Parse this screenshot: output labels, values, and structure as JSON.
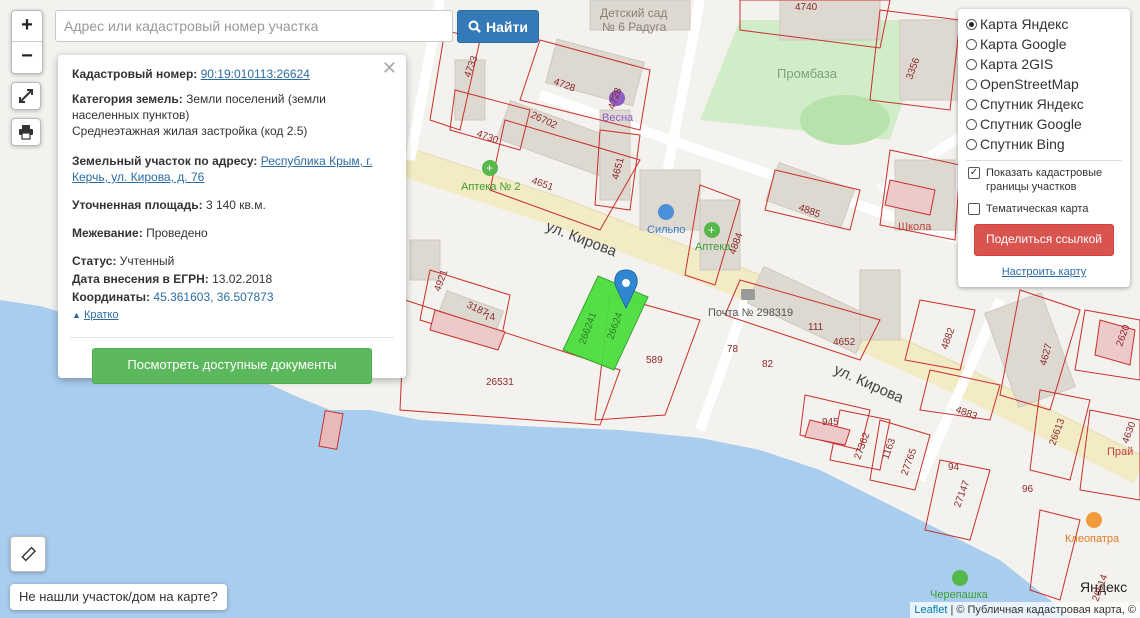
{
  "search": {
    "placeholder": "Адрес или кадастровый номер участка",
    "button_label": "Найти"
  },
  "zoom": {
    "in": "+",
    "out": "−"
  },
  "popup": {
    "cadastral_label": "Кадастровый номер:",
    "cadastral_value": "90:19:010113:26624",
    "category_label": "Категория земель:",
    "category_value": "Земли поселений (земли населенных пунктов)",
    "usage_value": "Среднеэтажная жилая застройка (код 2.5)",
    "address_label": "Земельный участок по адресу:",
    "address_value": "Республика Крым, г. Керчь, ул. Кирова, д. 76",
    "area_label": "Уточненная площадь:",
    "area_value": "3 140 кв.м.",
    "survey_label": "Межевание:",
    "survey_value": "Проведено",
    "status_label": "Статус:",
    "status_value": "Учтенный",
    "date_label": "Дата внесения в ЕГРН:",
    "date_value": "13.02.2018",
    "coords_label": "Координаты:",
    "coords_value": "45.361603, 36.507873",
    "brief_link": "Кратко",
    "docs_button": "Посмотреть доступные документы"
  },
  "layers": {
    "options": [
      "Карта Яндекс",
      "Карта Google",
      "Карта 2GIS",
      "OpenStreetMap",
      "Спутник Яндекс",
      "Спутник Google",
      "Спутник Bing"
    ],
    "selected": "Карта Яндекс",
    "show_cadastral": "Показать кадастровые границы участков",
    "thematic": "Тематическая карта",
    "share_button": "Поделиться ссылкой",
    "configure_link": "Настроить карту"
  },
  "not_found": "Не нашли участок/дом на карте?",
  "attribution": {
    "leaflet": "Leaflet",
    "rest": "| © Публичная кадастровая карта, ©"
  },
  "map_labels": {
    "kindergarten": "Детский сад",
    "kindergarten2": "№ 6 Радуга",
    "prombaza": "Промбаза",
    "vesna": "Весна",
    "apteka2": "Аптека № 2",
    "silpo": "Сильпо",
    "apteka": "Аптека",
    "street1": "ул. Кирова",
    "street2": "ул. Кирова",
    "post": "Почта № 298319",
    "school": "Школа",
    "cleopatra": "Клеопатра",
    "cherepashka": "Черепашка",
    "pharmacy": "Прай",
    "yandex": "Яндекс",
    "parcel_main": "26624",
    "parcel_side": "266241",
    "numbers": [
      "4740",
      "4733",
      "4728",
      "4728",
      "26702",
      "4730",
      "4651",
      "4651",
      "4884",
      "4885",
      "3356",
      "26531",
      "589",
      "3187",
      "4921",
      "74",
      "78",
      "82",
      "111",
      "4652",
      "4882",
      "4883",
      "4627",
      "2620",
      "945",
      "27362",
      "1163",
      "27765",
      "94",
      "96",
      "27147",
      "26613",
      "4630",
      "26614"
    ]
  },
  "colors": {
    "water": "#a5cbee",
    "parcel_border": "#c9302c",
    "parcel_selected": "#4cde3e",
    "road": "#f6eec5",
    "building": "#dcd7cf",
    "green": "#c9ecc2"
  }
}
